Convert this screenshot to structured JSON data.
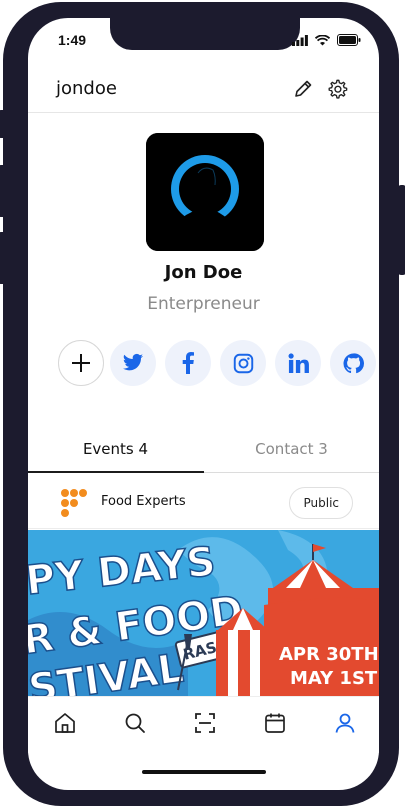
{
  "status_bar": {
    "time": "1:49"
  },
  "header": {
    "username": "jondoe"
  },
  "profile": {
    "name": "Jon Doe",
    "role": "Enterpreneur"
  },
  "social": [
    {
      "name": "add",
      "icon": "plus-icon"
    },
    {
      "name": "twitter",
      "icon": "twitter-icon"
    },
    {
      "name": "facebook",
      "icon": "facebook-icon"
    },
    {
      "name": "instagram",
      "icon": "instagram-icon"
    },
    {
      "name": "linkedin",
      "icon": "linkedin-icon"
    },
    {
      "name": "github",
      "icon": "github-icon"
    }
  ],
  "tabs": [
    {
      "label": "Events 4",
      "active": true
    },
    {
      "label": "Contact 3",
      "active": false
    }
  ],
  "event": {
    "organizer": "Food Experts",
    "visibility": "Public",
    "banner_text": {
      "line1": "PY DAYS",
      "line2": "R & FOOD",
      "line3": "STIVAL",
      "sign": "RASCALS",
      "date1": "APR 30TH",
      "date2": "MAY 1ST"
    }
  },
  "bottom_nav": [
    "home-icon",
    "search-icon",
    "scan-icon",
    "calendar-icon",
    "profile-icon"
  ],
  "colors": {
    "accent": "#1a66e8",
    "frame": "#1c1b2e",
    "banner_sky": "#3aa7e0",
    "tent_red": "#e34a2f"
  }
}
